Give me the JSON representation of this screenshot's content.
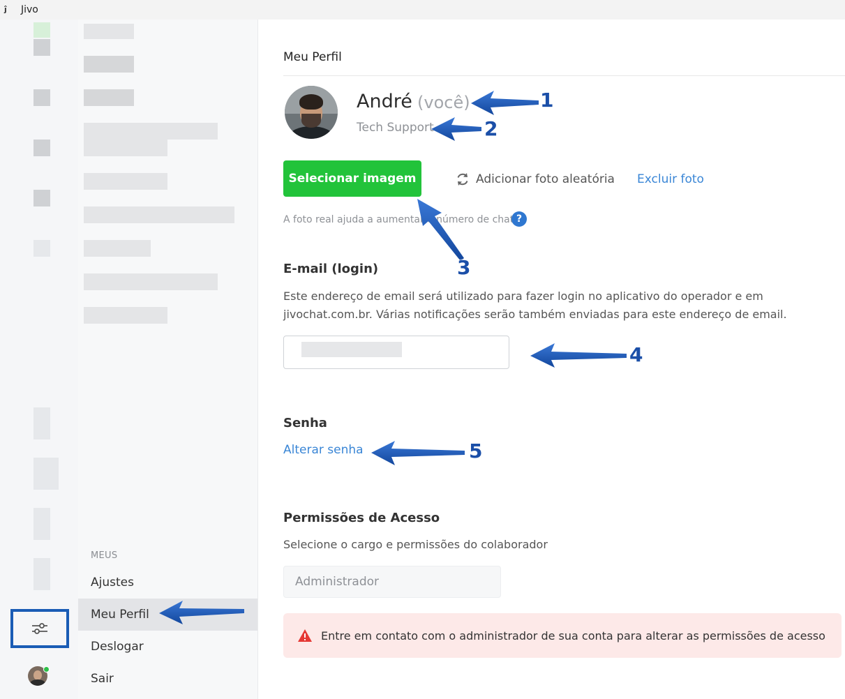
{
  "window": {
    "title": "Jivo"
  },
  "sidebar": {
    "section_label": "MEUS",
    "items": [
      {
        "label": "Ajustes"
      },
      {
        "label": "Meu Perfil",
        "active": true
      },
      {
        "label": "Deslogar"
      },
      {
        "label": "Sair"
      }
    ]
  },
  "rail": {
    "settings_icon": "sliders-icon",
    "status": "online"
  },
  "profile": {
    "page_title": "Meu Perfil",
    "name": "André",
    "you_label": "(você)",
    "role": "Tech Support",
    "select_image_label": "Selecionar imagem",
    "random_photo_label": "Adicionar foto aleatória",
    "delete_photo_label": "Excluir foto",
    "hint": "A foto real ajuda a aumentar o número de chats.",
    "help_label": "?"
  },
  "email": {
    "heading": "E-mail (login)",
    "desc_line1": "Este endereço de email será utilizado para fazer login no aplicativo do operador e em",
    "desc_line2": "jivochat.com.br. Várias notificações serão também enviadas para este endereço de email."
  },
  "password": {
    "heading": "Senha",
    "change_label": "Alterar senha"
  },
  "permissions": {
    "heading": "Permissões de Acesso",
    "desc": "Selecione o cargo e permissões do colaborador",
    "role_value": "Administrador",
    "alert_text": "Entre em contato com o administrador de sua conta para alterar as permissões de acesso"
  },
  "annotations": {
    "n1": "1",
    "n2": "2",
    "n3": "3",
    "n4": "4",
    "n5": "5",
    "arrow_color": "#1b4fa8"
  },
  "colors": {
    "primary_button": "#22c33a",
    "link": "#3a86d6",
    "alert_bg": "#fde9e8",
    "alert_icon": "#e53935"
  }
}
